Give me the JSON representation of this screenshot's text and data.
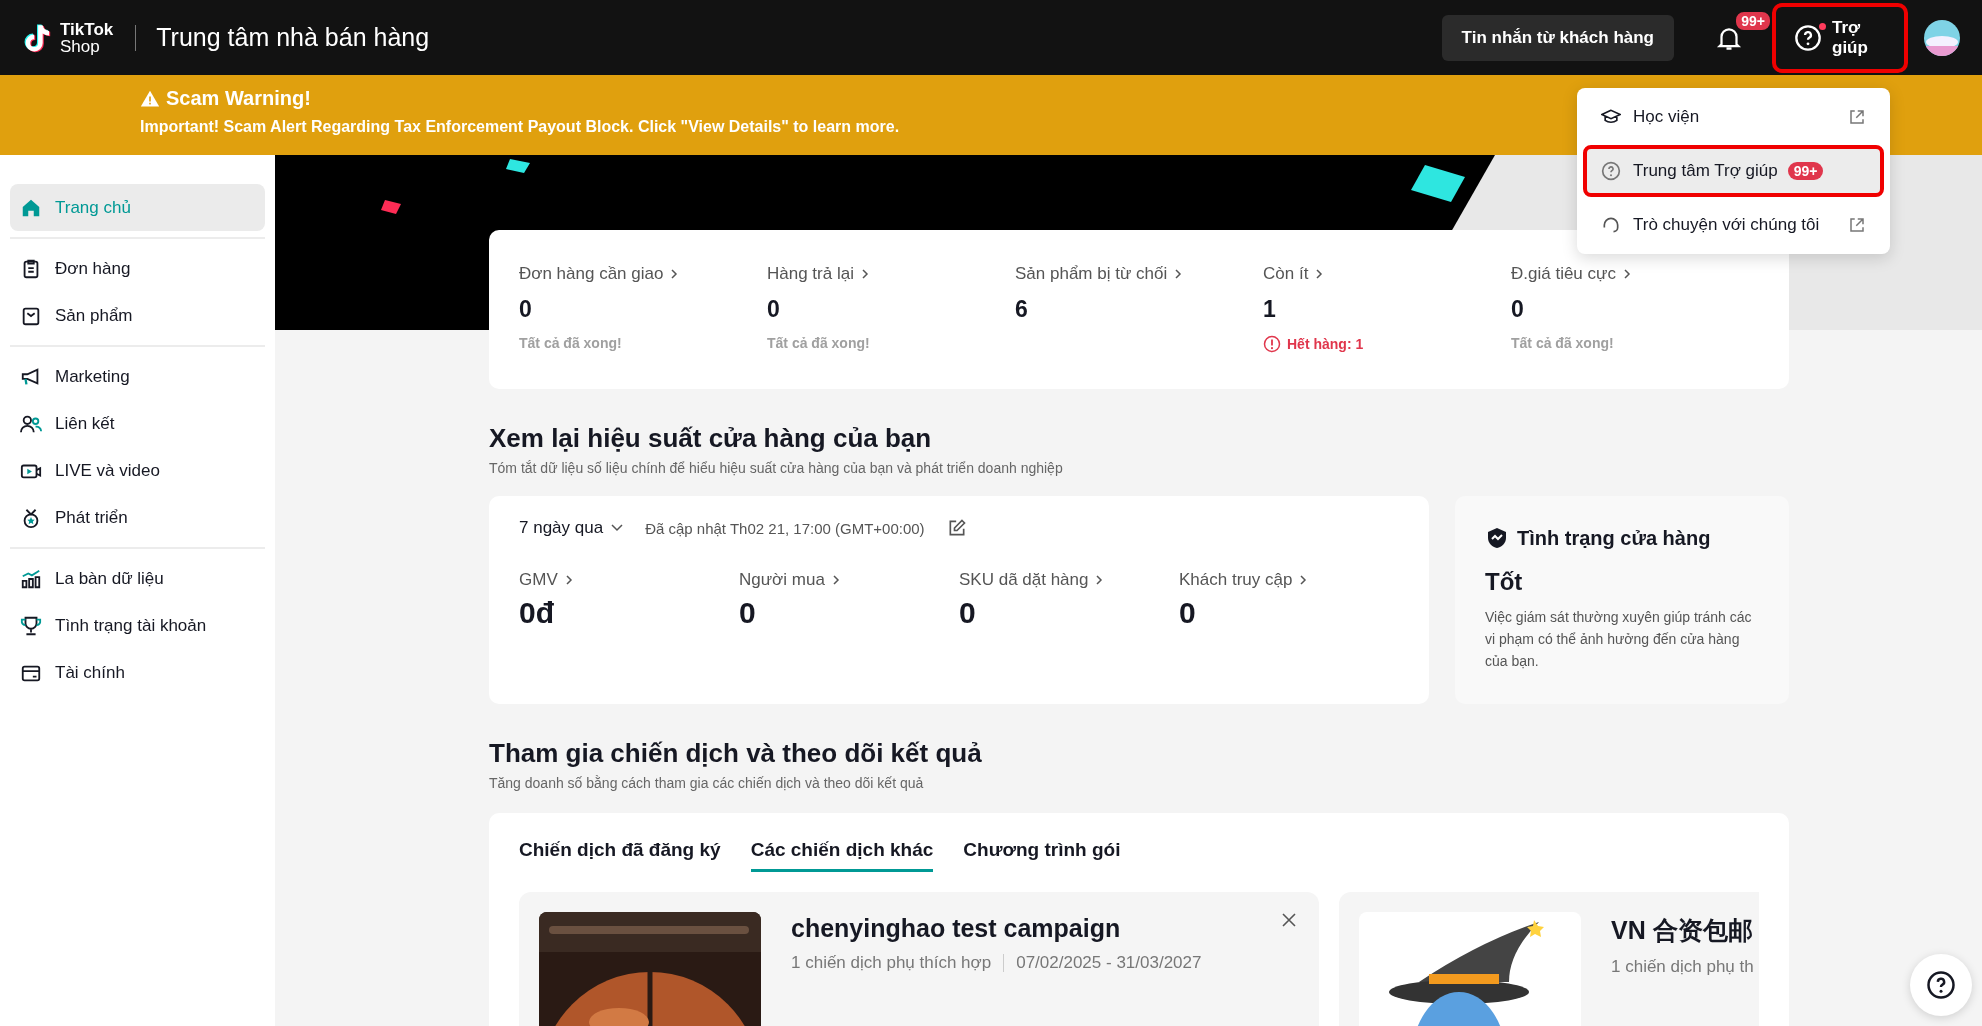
{
  "header": {
    "logo_top": "TikTok",
    "logo_bottom": "Shop",
    "title": "Trung tâm nhà bán hàng",
    "message_button": "Tin nhắn từ khách hàng",
    "notification_badge": "99+",
    "help_button": {
      "label": "Trợ giúp",
      "highlighted": true,
      "unread": true
    }
  },
  "warning": {
    "title": "Scam Warning!",
    "message": "Important! Scam Alert Regarding Tax Enforcement Payout Block. Click \"View Details\" to learn more."
  },
  "sidebar": {
    "groups": [
      {
        "items": [
          {
            "label": "Trang chủ",
            "selected": true
          }
        ]
      },
      {
        "items": [
          {
            "label": "Đơn hàng",
            "selected": false
          },
          {
            "label": "Sản phẩm",
            "selected": false
          }
        ]
      },
      {
        "items": [
          {
            "label": "Marketing",
            "selected": false
          },
          {
            "label": "Liên kết",
            "selected": false
          },
          {
            "label": "LIVE và video",
            "selected": false
          },
          {
            "label": "Phát triển",
            "selected": false
          }
        ]
      },
      {
        "items": [
          {
            "label": "La bàn dữ liệu",
            "selected": false
          },
          {
            "label": "Tình trạng tài khoản",
            "selected": false
          },
          {
            "label": "Tài chính",
            "selected": false
          }
        ]
      }
    ]
  },
  "help_menu": {
    "items": [
      {
        "kind": "academy",
        "label": "Học viện",
        "external": true,
        "highlighted": false
      },
      {
        "kind": "help",
        "label": "Trung tâm Trợ giúp",
        "badge": "99+",
        "external": false,
        "highlighted": true
      },
      {
        "kind": "chat",
        "label": "Trò chuyện với chúng tôi",
        "external": true,
        "highlighted": false
      }
    ]
  },
  "stats": [
    {
      "kind": "done",
      "label": "Đơn hàng cần giao",
      "value": "0",
      "note": "Tất cả đã xong!"
    },
    {
      "kind": "done",
      "label": "Hàng trả lại",
      "value": "0",
      "note": "Tất cả đã xong!"
    },
    {
      "kind": "plain",
      "label": "Sản phẩm bị từ chối",
      "value": "6"
    },
    {
      "kind": "alert",
      "label": "Còn ít",
      "value": "1",
      "note": "Hết hàng: 1"
    },
    {
      "kind": "done",
      "label": "Đ.giá tiêu cực",
      "value": "0",
      "note": "Tất cả đã xong!"
    }
  ],
  "performance": {
    "title": "Xem lại hiệu suất cửa hàng của bạn",
    "subtitle": "Tóm tắt dữ liệu số liệu chính để hiểu hiệu suất cửa hàng của bạn và phát triển doanh nghiệp",
    "period": "7 ngày qua",
    "updated": "Đã cập nhật Th02 21, 17:00 (GMT+00:00)",
    "metrics": [
      {
        "label": "GMV",
        "value": "0đ"
      },
      {
        "label": "Người mua",
        "value": "0"
      },
      {
        "label": "SKU dã dặt hàng",
        "value": "0"
      },
      {
        "label": "Khách truy cập",
        "value": "0"
      }
    ]
  },
  "store_health": {
    "title": "Tình trạng cửa hàng",
    "status": "Tốt",
    "description": "Việc giám sát thường xuyên giúp tránh các vi phạm có thể ảnh hưởng đến cửa hàng của bạn."
  },
  "campaigns": {
    "title": "Tham gia chiến dịch và theo dõi kết quả",
    "subtitle": "Tăng doanh số bằng cách tham gia các chiến dịch và theo dõi kết quả",
    "tabs": [
      {
        "label": "Chiến dịch đã đăng ký",
        "selected": false
      },
      {
        "label": "Các chiến dịch khác",
        "selected": true
      },
      {
        "label": "Chương trình gói",
        "selected": false
      }
    ],
    "items": [
      {
        "title": "chenyinghao test campaign",
        "subcampaigns": "1 chiến dịch phụ thích hợp",
        "dates": "07/02/2025 - 31/03/2027",
        "closable": true
      },
      {
        "kind": "cartoon",
        "title": "VN 合资包邮",
        "subcampaigns": "1 chiến dịch phụ th"
      }
    ]
  }
}
